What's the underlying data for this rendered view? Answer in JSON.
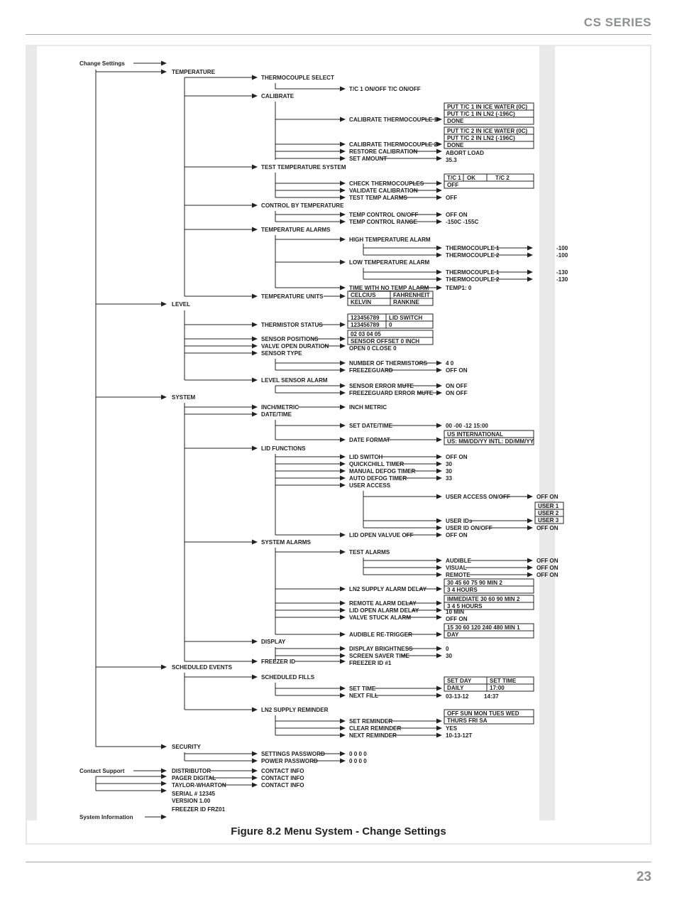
{
  "header": "CS SERIES",
  "pageNumber": "23",
  "caption": "Figure 8.2 Menu System - Change Settings",
  "roots": {
    "change": "Change Settings",
    "contact": "Contact Support",
    "sysinfo": "System Information"
  },
  "cats": {
    "temp": "TEMPERATURE",
    "level": "LEVEL",
    "system": "SYSTEM",
    "sched": "SCHEDULED EVENTS",
    "sec": "SECURITY"
  },
  "contact": {
    "distributor": "DISTRIBUTOR",
    "pager": "PAGER DIGITAL",
    "tw": "TAYLOR-WHARTON",
    "info": "CONTACT INFO"
  },
  "sys": {
    "serial": "SERIAL # 12345",
    "version": "VERSION 1.00",
    "freezer": "FREEZER ID   FRZ01"
  },
  "temp": {
    "tcsel": "THERMOCOUPLE SELECT",
    "calibrate": "CALIBRATE",
    "test": "TEST TEMPERATURE SYSTEM",
    "ctrl": "CONTROL BY TEMPERATURE",
    "alarms": "TEMPERATURE ALARMS",
    "units": "TEMPERATURE UNITS",
    "tc1onoff": "T/C 1 ON/OFF  T/C ON/OFF",
    "cal1": "CALIBRATE THERMOCOUPLE 1",
    "cal2": "CALIBRATE THERMOCOUPLE 2",
    "restore": "RESTORE CALIBRATION",
    "setamt": "SET AMOUNT",
    "check": "CHECK THERMOCOUPLES",
    "validate": "VALIDATE CALIBRATION",
    "testalm": "TEST TEMP ALARMS",
    "ctrlon": "TEMP CONTROL ON/OFF",
    "ctrlrng": "TEMP CONTROL RANGE",
    "hi": "HIGH TEMPERATURE ALARM",
    "lo": "LOW TEMPERATURE ALARM",
    "noalm": "TIME WITH NO TEMP ALARM",
    "c": "CELCIUS",
    "f": "FAHRENHEIT",
    "k": "KELVIN",
    "r": "RANKINE",
    "box1a": "PUT T/C 1 IN ICE WATER (0C)",
    "box1b": "PUT T/C 1 IN LN2 (-196C)",
    "done": "DONE",
    "box2a": "PUT T/C 2 IN ICE WATER (0C)",
    "box2b": "PUT T/C 2 IN LN2 (-196C)",
    "abort": "ABORT LOAD",
    "v353": "35.3",
    "tc1": "T/C 1",
    "ok": "OK",
    "tc2": "T/C 2",
    "off": "OFF",
    "offon": "OFF ON",
    "range": "-150C     -155C",
    "tcpl1": "THERMOCOUPLE 1",
    "tcpl2": "THERMOCOUPLE 2",
    "m100": "-100",
    "m130": "-130",
    "t1": "TEMP1: 0"
  },
  "level": {
    "thermstat": "THERMISTOR STATUS",
    "senspos": "SENSOR POSITIONS",
    "valveopen": "VALVE OPEN DURATION",
    "senstype": "SENSOR TYPE",
    "lvlalm": "LEVEL SENSOR ALARM",
    "n9": "123456789",
    "lid": "LID SWITCH",
    "zero": "0",
    "pos": "02   03   04   05",
    "offset": "SENSOR OFFSET   0 INCH",
    "oc": "OPEN   0        CLOSE   0",
    "nth": "NUMBER OF THERMISTORS",
    "fg": "FREEZEGUARD",
    "sem": "SENSOR ERROR MUTE",
    "fgm": "FREEZEGUARD ERROR MUTE",
    "v40": "4 0",
    "onoff": "ON OFF"
  },
  "sysm": {
    "im": "INCH/METRIC",
    "dt": "DATE/TIME",
    "lid": "LID FUNCTIONS",
    "alm": "SYSTEM ALARMS",
    "disp": "DISPLAY",
    "fid": "FREEZER ID",
    "imv": "INCH  METRIC",
    "setdt": "SET DATE/TIME",
    "datefmt": "DATE FORMAT",
    "dtv": "00   -00   -12   15:00",
    "fmt1": "US    INTERNATIONAL",
    "fmt2": "US: MM/DD/YY  INTL: DD/MM/YY",
    "lidsw": "LID SWITCH",
    "qc": "QUICKCHILL TIMER",
    "md": "MANUAL DEFOG TIMER",
    "ad": "AUTO DEFOG TIMER",
    "ua": "USER ACCESS",
    "v30": "30",
    "v33": "33",
    "uaon": "USER ACCESS ON/OFF",
    "uids": "USER IDs",
    "uidon": "USER ID ON/OFF",
    "u1": "USER 1",
    "u2": "USER 2",
    "u3": "USER 3",
    "offon": "OFF ON",
    "lidopen": "LID OPEN VALVUE OFF",
    "testalm": "TEST ALARMS",
    "aud": "AUDIBLE",
    "vis": "VISUAL",
    "rem": "REMOTE",
    "ln2": "LN2 SUPPLY ALARM DELAY",
    "ln2a": "30 45 60 75 90 MIN    2",
    "ln2b": "3 4  HOURS",
    "rad": "REMOTE ALARM DELAY",
    "radv": "IMMEDIATE 30 60 90 MIN    2",
    "radv2": "3 4 5 HOURS",
    "load": "LID OPEN ALARM DELAY",
    "loadv": "10 MIN",
    "vstuck": "VALVE STUCK ALARM",
    "retrig": "AUDIBLE RE-TRIGGER",
    "retriga": "15 30 60 120 240 480 MIN   1",
    "retrigb": "DAY",
    "bright": "DISPLAY BRIGHTNESS",
    "ss": "SCREEN SAVER TIME",
    "fidv": "FREEZER ID #1",
    "b0": "0"
  },
  "sched": {
    "fills": "SCHEDULED FILLS",
    "settime": "SET TIME",
    "nextfill": "NEXT FILL",
    "setday": "SET DAY",
    "setday2": "SET TIME",
    "daily": "DAILY",
    "d17": "17:00",
    "d031312": "03-13-12",
    "d1437": "14:37",
    "ln2": "LN2 SUPPLY REMINDER",
    "setrem": "SET REMINDER",
    "clr": "CLEAR REMINDER",
    "nextrem": "NEXT REMINDER",
    "days": "OFF SUN MON TUES WED",
    "days2": "THURS FRI SA",
    "yes": "YES",
    "d101312": "10-13-12T"
  },
  "sec": {
    "set": "SETTINGS PASSWORD",
    "pow": "POWER PASSWORD",
    "z": "0   0   0   0"
  }
}
